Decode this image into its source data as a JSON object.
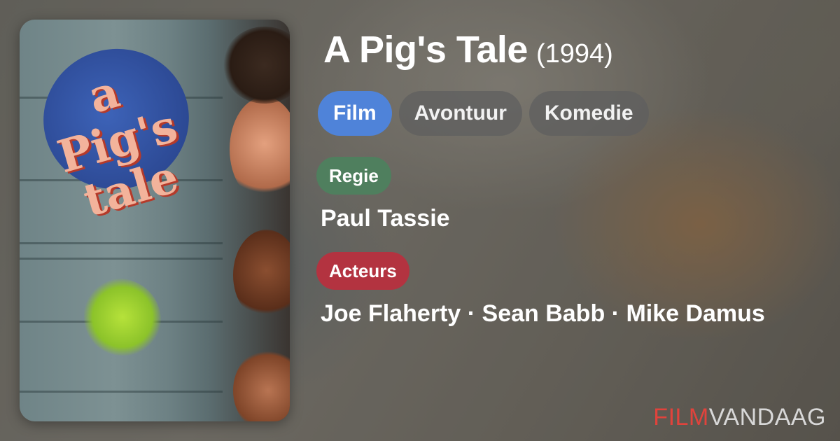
{
  "movie": {
    "title": "A Pig's Tale",
    "year": "(1994)"
  },
  "poster": {
    "logo_text": "a Pig's tale"
  },
  "genres": [
    "Film",
    "Avontuur",
    "Komedie"
  ],
  "director": {
    "label": "Regie",
    "name": "Paul Tassie"
  },
  "cast": {
    "label": "Acteurs",
    "names": "Joe Flaherty · Sean Babb · Mike Damus"
  },
  "brand": {
    "part1": "FILM",
    "part2": "VANDAAG",
    "colors": {
      "accent": "#e0433c",
      "rest": "#d8d8d8"
    }
  },
  "colors": {
    "genre_primary": "#4f83d9",
    "regie_badge": "#4f7f5e",
    "acteurs_badge": "#b33340"
  }
}
